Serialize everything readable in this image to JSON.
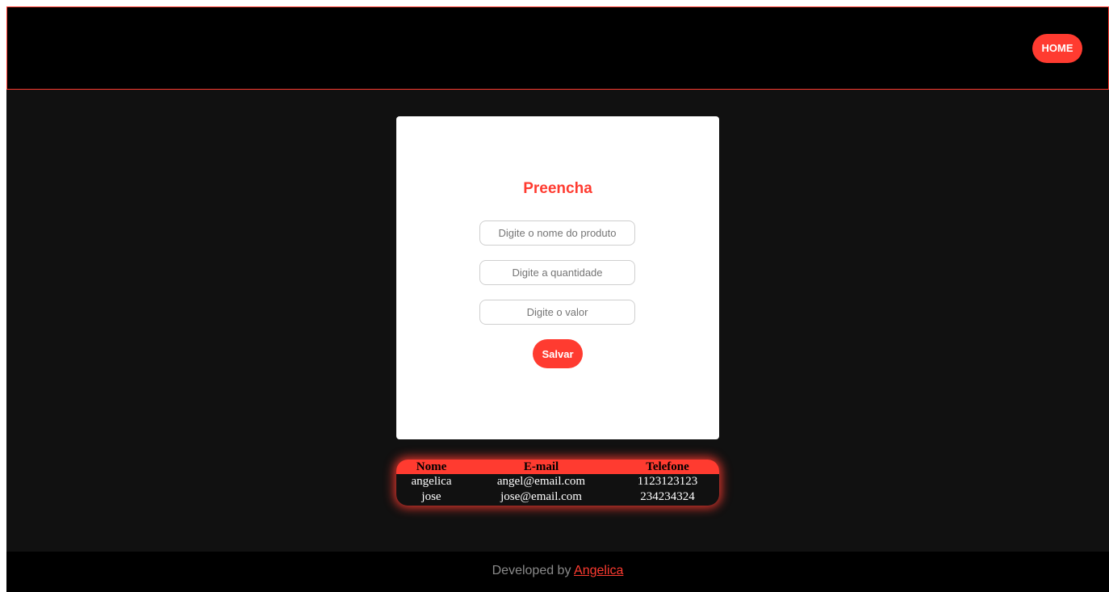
{
  "header": {
    "home_label": "HOME"
  },
  "form": {
    "title": "Preencha",
    "fields": [
      {
        "placeholder": "Digite o nome do produto",
        "value": ""
      },
      {
        "placeholder": "Digite a quantidade",
        "value": ""
      },
      {
        "placeholder": "Digite o valor",
        "value": ""
      }
    ],
    "save_label": "Salvar"
  },
  "table": {
    "headers": [
      "Nome",
      "E-mail",
      "Telefone"
    ],
    "rows": [
      [
        "angelica",
        "angel@email.com",
        "1123123123"
      ],
      [
        "jose",
        "jose@email.com",
        "234234324"
      ]
    ]
  },
  "footer": {
    "prefix": "Developed by ",
    "author": "Angelica"
  },
  "colors": {
    "accent": "#ff3b30",
    "page_background": "#111111",
    "header_background": "#000000"
  }
}
